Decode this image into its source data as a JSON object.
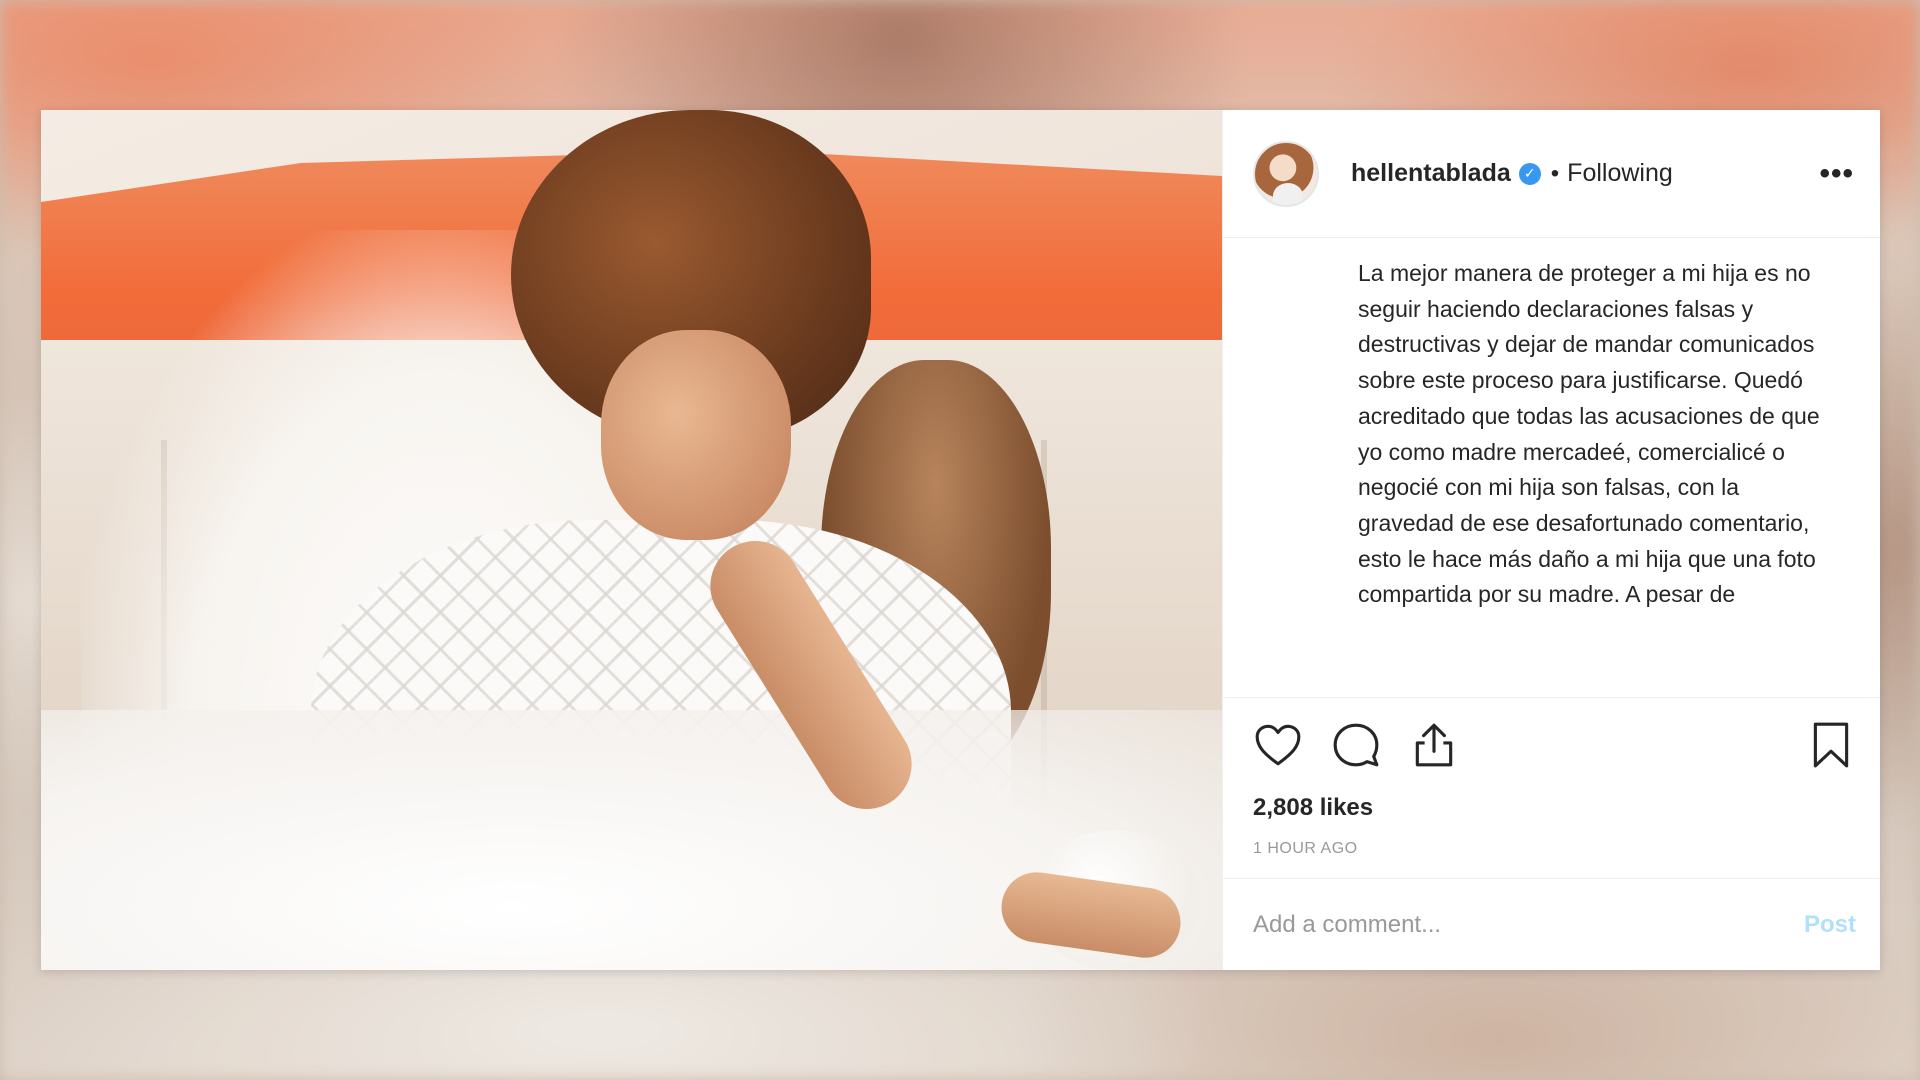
{
  "post": {
    "username": "hellentablada",
    "verified_mark": "✓",
    "separator": "•",
    "follow_status": "Following",
    "more_label": "•••",
    "caption": "La mejor manera de proteger a mi hija es no seguir haciendo declaraciones falsas y destructivas y dejar de mandar comunicados sobre este proceso para justificarse. Quedó acreditado que todas las acusaciones de que yo como madre mercadeé, comercialicé o negocié con mi hija son falsas, con la gravedad de ese desafortunado comentario, esto le hace más daño a mi hija que una foto compartida por su madre. A pesar de",
    "likes": "2,808 likes",
    "time": "1 HOUR AGO",
    "comment_placeholder": "Add a comment...",
    "post_button": "Post"
  },
  "icons": {
    "like": "heart-icon",
    "comment": "comment-bubble-icon",
    "share": "share-upload-icon",
    "save": "bookmark-icon",
    "verified": "verified-badge-icon",
    "more": "more-options-icon"
  },
  "colors": {
    "verified_blue": "#3897f0",
    "post_button_disabled": "#b2dffc",
    "text_primary": "#262626",
    "text_muted": "#999999"
  }
}
